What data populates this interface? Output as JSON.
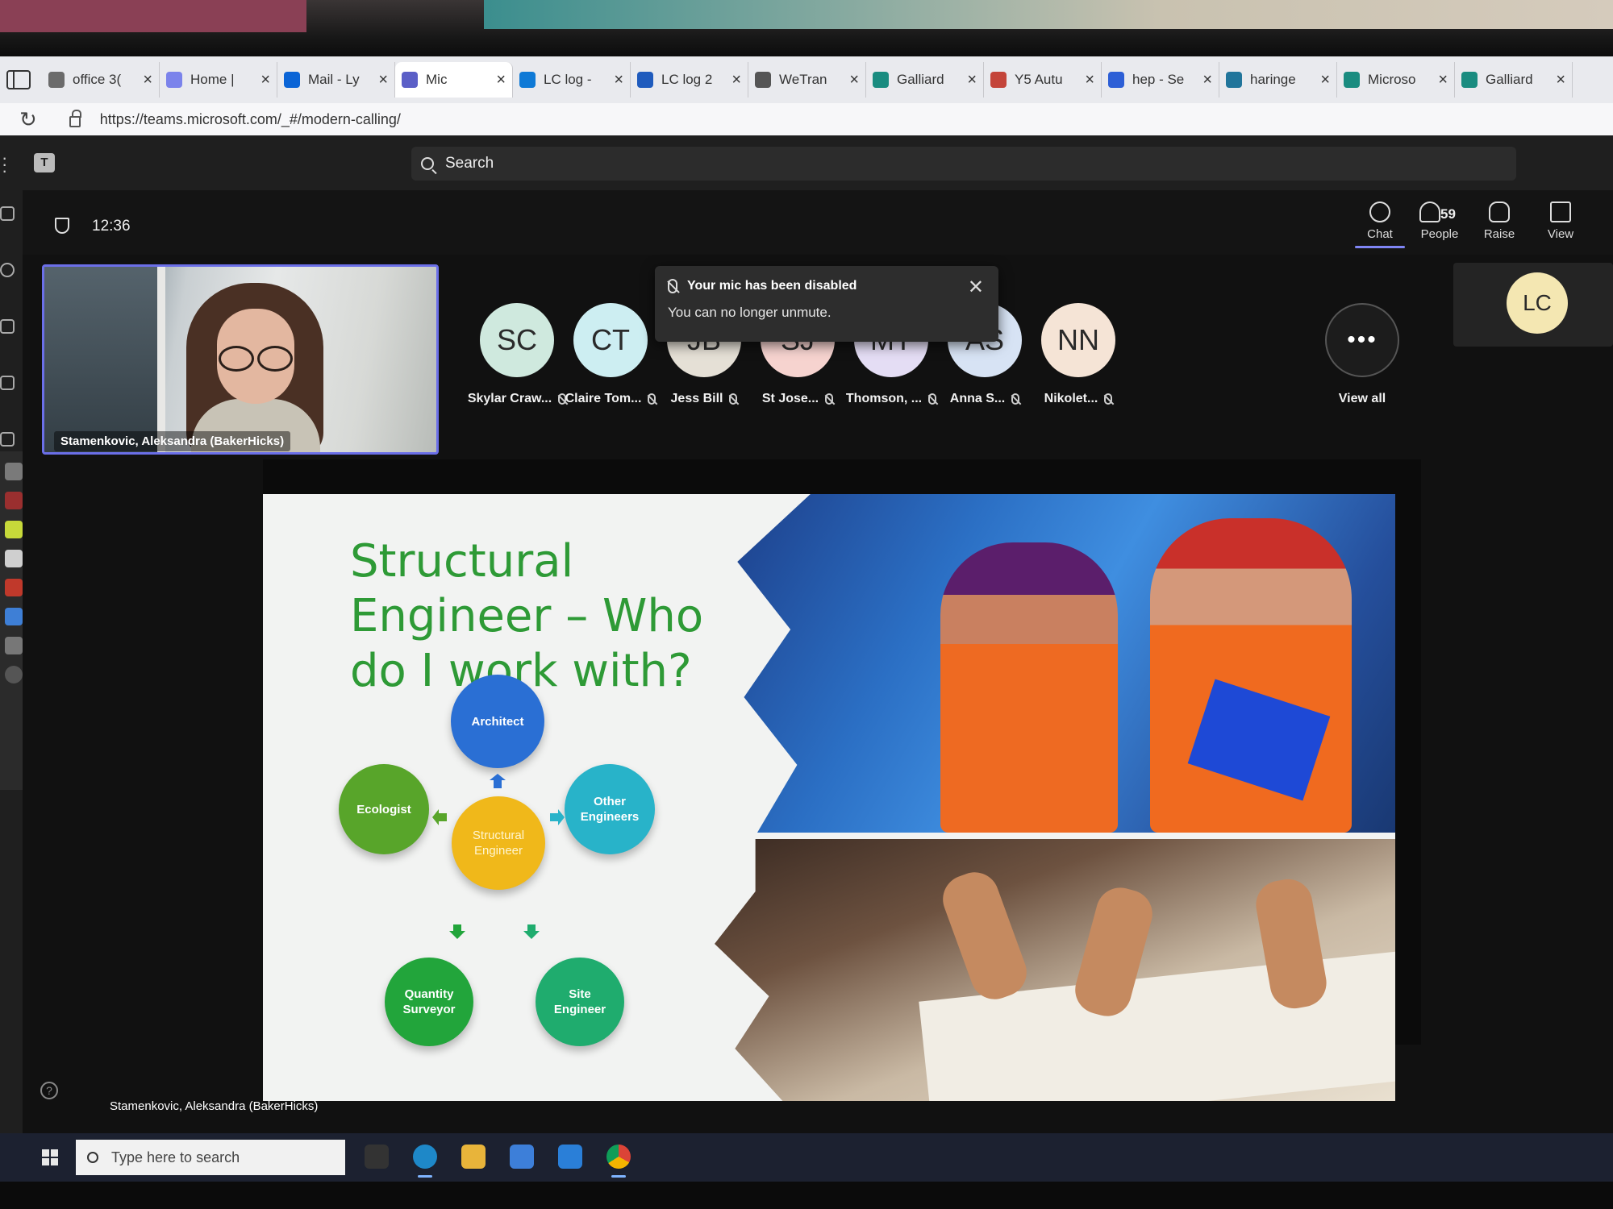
{
  "browser": {
    "tabs": [
      {
        "title": "office 3(",
        "color": "#6b6b6b"
      },
      {
        "title": "Home |",
        "color": "#7b83eb"
      },
      {
        "title": "Mail - Ly",
        "color": "#0a64d6"
      },
      {
        "title": "Mic",
        "color": "#5b5fc7",
        "active": true
      },
      {
        "title": "LC log -",
        "color": "#0f7ad6"
      },
      {
        "title": "LC log 2",
        "color": "#1f5bbd"
      },
      {
        "title": "WeTran",
        "color": "#555555"
      },
      {
        "title": "Galliard",
        "color": "#1a8c80"
      },
      {
        "title": "Y5 Autu",
        "color": "#c4453a"
      },
      {
        "title": "hep - Se",
        "color": "#2d5fd6"
      },
      {
        "title": "haringe",
        "color": "#21759b"
      },
      {
        "title": "Microso",
        "color": "#1a8c80"
      },
      {
        "title": "Galliard",
        "color": "#1a8c80"
      }
    ],
    "url": "https://teams.microsoft.com/_#/modern-calling/"
  },
  "teams": {
    "search_label": "Search",
    "call_time": "12:36",
    "controls": {
      "chat": "Chat",
      "people": "People",
      "people_count": "59",
      "raise": "Raise",
      "view": "View"
    },
    "video_tile_name": "Stamenkovic, Aleksandra (BakerHicks)",
    "participants": [
      {
        "initials": "SC",
        "name": "Skylar Craw...",
        "color": "#cfe9de"
      },
      {
        "initials": "CT",
        "name": "Claire Tom...",
        "color": "#cdeef2"
      },
      {
        "initials": "JB",
        "name": "Jess Bill",
        "color": "#e5e0d6"
      },
      {
        "initials": "SJ",
        "name": "St Jose...",
        "color": "#f6d3cf"
      },
      {
        "initials": "MT",
        "name": "Thomson, ...",
        "color": "#e4ddf4"
      },
      {
        "initials": "AS",
        "name": "Anna S...",
        "color": "#d7e3f4"
      },
      {
        "initials": "NN",
        "name": "Nikolet...",
        "color": "#f5e4d6"
      }
    ],
    "view_all_label": "View all",
    "more_label": "•••",
    "pinned_avatar": "LC",
    "toast": {
      "title": "Your mic has been disabled",
      "body": "You can no longer unmute."
    },
    "speaker_caption": "Stamenkovic, Aleksandra (BakerHicks)",
    "help_label": "?"
  },
  "slide": {
    "title": "Structural Engineer – Who do I work with?",
    "center": "Structural Engineer",
    "nodes": {
      "architect": "Architect",
      "ecologist": "Ecologist",
      "other_engineers": "Other Engineers",
      "quantity_surveyor": "Quantity Surveyor",
      "site_engineer": "Site Engineer"
    },
    "colors": {
      "architect": "#2a6fd4",
      "ecologist": "#58a52a",
      "other_engineers": "#28b3c9",
      "quantity_surveyor": "#22a53b",
      "site_engineer": "#1fac6e",
      "center": "#f0b81a",
      "title": "#2e9a36"
    }
  },
  "taskbar": {
    "search_placeholder": "Type here to search"
  }
}
